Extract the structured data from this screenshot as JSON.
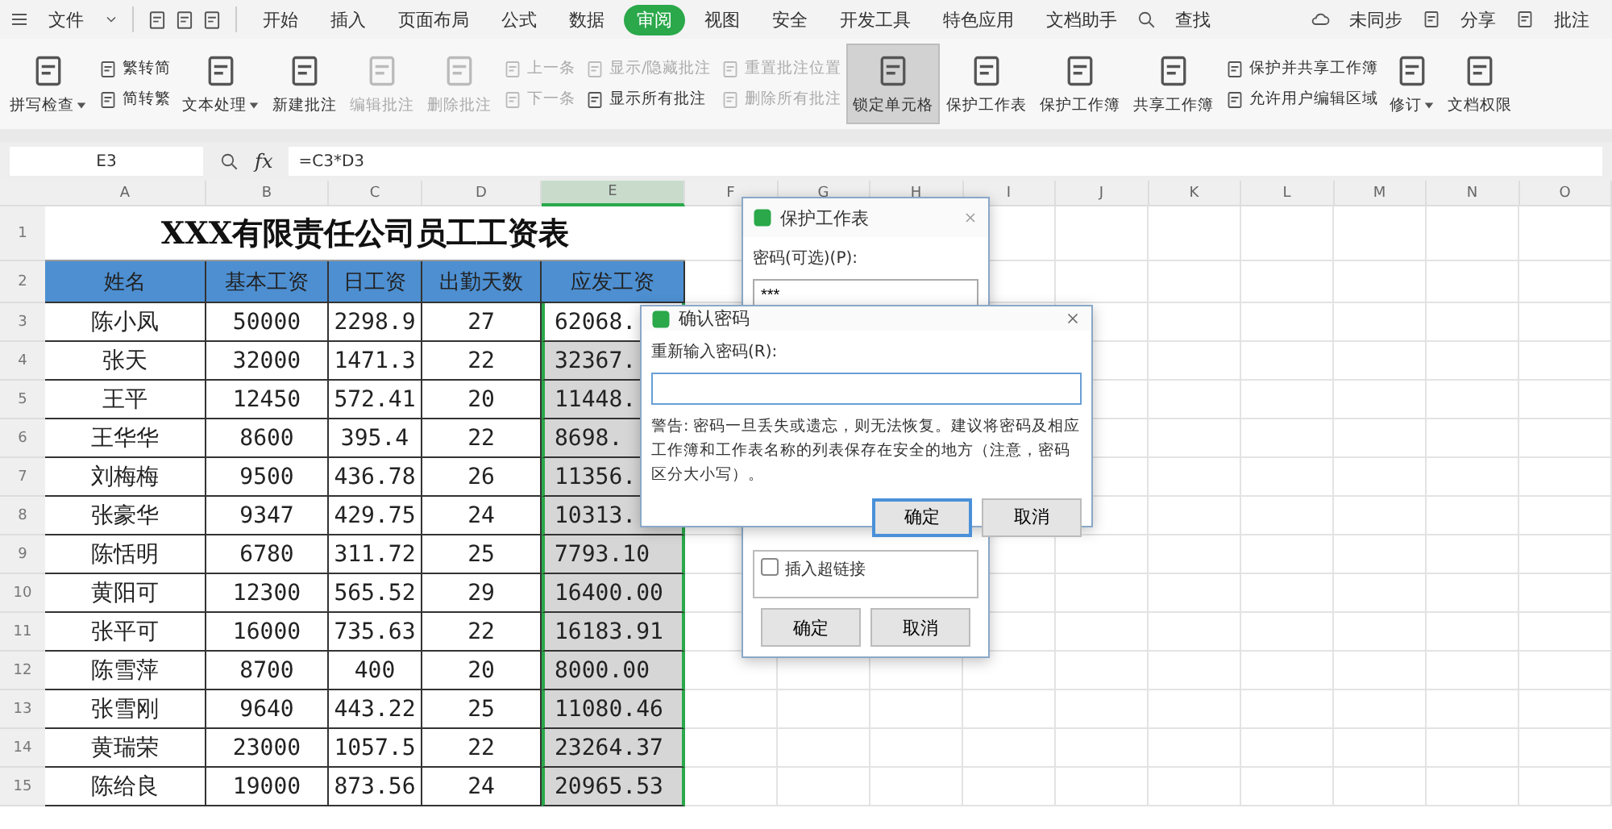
{
  "menu": {
    "file": "文件",
    "tabs": [
      {
        "label": "开始",
        "selected": false
      },
      {
        "label": "插入",
        "selected": false
      },
      {
        "label": "页面布局",
        "selected": false
      },
      {
        "label": "公式",
        "selected": false
      },
      {
        "label": "数据",
        "selected": false
      },
      {
        "label": "审阅",
        "selected": true
      },
      {
        "label": "视图",
        "selected": false
      },
      {
        "label": "安全",
        "selected": false
      },
      {
        "label": "开发工具",
        "selected": false
      },
      {
        "label": "特色应用",
        "selected": false
      },
      {
        "label": "文档助手",
        "selected": false
      }
    ],
    "search": "查找",
    "actions": [
      "未同步",
      "分享",
      "批注"
    ]
  },
  "ribbon": [
    {
      "kind": "large",
      "label": "拼写检查",
      "dropdown": true,
      "disabled": false,
      "selected": false
    },
    {
      "kind": "stack",
      "items": [
        {
          "label": "繁转简",
          "disabled": false
        },
        {
          "label": "简转繁",
          "disabled": false
        }
      ]
    },
    {
      "kind": "large",
      "label": "文本处理",
      "dropdown": true,
      "disabled": false,
      "selected": false
    },
    {
      "kind": "large",
      "label": "新建批注",
      "dropdown": false,
      "disabled": false,
      "selected": false
    },
    {
      "kind": "large",
      "label": "编辑批注",
      "dropdown": false,
      "disabled": true,
      "selected": false
    },
    {
      "kind": "large",
      "label": "删除批注",
      "dropdown": false,
      "disabled": true,
      "selected": false
    },
    {
      "kind": "stack",
      "items": [
        {
          "label": "上一条",
          "disabled": true
        },
        {
          "label": "下一条",
          "disabled": true
        }
      ]
    },
    {
      "kind": "stack",
      "items": [
        {
          "label": "显示/隐藏批注",
          "disabled": true
        },
        {
          "label": "显示所有批注",
          "disabled": false
        }
      ]
    },
    {
      "kind": "stack",
      "items": [
        {
          "label": "重置批注位置",
          "disabled": true
        },
        {
          "label": "删除所有批注",
          "disabled": true
        }
      ]
    },
    {
      "kind": "large",
      "label": "锁定单元格",
      "dropdown": false,
      "disabled": false,
      "selected": true
    },
    {
      "kind": "large",
      "label": "保护工作表",
      "dropdown": false,
      "disabled": false,
      "selected": false
    },
    {
      "kind": "large",
      "label": "保护工作簿",
      "dropdown": false,
      "disabled": false,
      "selected": false
    },
    {
      "kind": "large",
      "label": "共享工作簿",
      "dropdown": false,
      "disabled": false,
      "selected": false
    },
    {
      "kind": "stack",
      "items": [
        {
          "label": "保护并共享工作簿",
          "disabled": false
        },
        {
          "label": "允许用户编辑区域",
          "disabled": false
        }
      ]
    },
    {
      "kind": "large",
      "label": "修订",
      "dropdown": true,
      "disabled": false,
      "selected": false
    },
    {
      "kind": "large",
      "label": "文档权限",
      "dropdown": false,
      "disabled": false,
      "selected": false
    }
  ],
  "formula_bar": {
    "name_box": "E3",
    "fx": "fx",
    "formula": "=C3*D3"
  },
  "sheet": {
    "columns": [
      {
        "label": "A",
        "selected": false
      },
      {
        "label": "B",
        "selected": false
      },
      {
        "label": "C",
        "selected": false
      },
      {
        "label": "D",
        "selected": false
      },
      {
        "label": "E",
        "selected": true
      },
      {
        "label": "F",
        "selected": false
      },
      {
        "label": "G",
        "selected": false
      },
      {
        "label": "H",
        "selected": false
      },
      {
        "label": "I",
        "selected": false
      },
      {
        "label": "J",
        "selected": false
      },
      {
        "label": "K",
        "selected": false
      },
      {
        "label": "L",
        "selected": false
      },
      {
        "label": "M",
        "selected": false
      },
      {
        "label": "N",
        "selected": false
      },
      {
        "label": "O",
        "selected": false
      }
    ],
    "row_numbers": [
      "1",
      "2",
      "3",
      "4",
      "5",
      "6",
      "7",
      "8",
      "9",
      "10",
      "11",
      "12",
      "13",
      "14",
      "15"
    ],
    "title": "XXX有限责任公司员工工资表",
    "headers": [
      "姓名",
      "基本工资",
      "日工资",
      "出勤天数",
      "应发工资"
    ],
    "rows": [
      {
        "cells": [
          "陈小凤",
          "50000",
          "2298.9",
          "27",
          "62068."
        ],
        "highlighted": false
      },
      {
        "cells": [
          "张天",
          "32000",
          "1471.3",
          "22",
          "32367."
        ],
        "highlighted": true
      },
      {
        "cells": [
          "王平",
          "12450",
          "572.41",
          "20",
          "11448."
        ],
        "highlighted": true
      },
      {
        "cells": [
          "王华华",
          "8600",
          "395.4",
          "22",
          "8698."
        ],
        "highlighted": true
      },
      {
        "cells": [
          "刘梅梅",
          "9500",
          "436.78",
          "26",
          "11356."
        ],
        "highlighted": true
      },
      {
        "cells": [
          "张豪华",
          "9347",
          "429.75",
          "24",
          "10313."
        ],
        "highlighted": true
      },
      {
        "cells": [
          "陈恬明",
          "6780",
          "311.72",
          "25",
          "7793.10"
        ],
        "highlighted": true
      },
      {
        "cells": [
          "黄阳可",
          "12300",
          "565.52",
          "29",
          "16400.00"
        ],
        "highlighted": true
      },
      {
        "cells": [
          "张平可",
          "16000",
          "735.63",
          "22",
          "16183.91"
        ],
        "highlighted": true
      },
      {
        "cells": [
          "陈雪萍",
          "8700",
          "400",
          "20",
          "8000.00"
        ],
        "highlighted": true
      },
      {
        "cells": [
          "张雪刚",
          "9640",
          "443.22",
          "25",
          "11080.46"
        ],
        "highlighted": true
      },
      {
        "cells": [
          "黄瑞荣",
          "23000",
          "1057.5",
          "22",
          "23264.37"
        ],
        "highlighted": true
      },
      {
        "cells": [
          "陈给良",
          "19000",
          "873.56",
          "24",
          "20965.53"
        ],
        "highlighted": true
      }
    ]
  },
  "protect_dialog": {
    "title": "保护工作表",
    "label": "密码(可选)(P):",
    "value": "***",
    "options": [
      {
        "label": "插入超链接",
        "checked": false
      }
    ],
    "buttons": [
      "确定",
      "取消"
    ]
  },
  "confirm_dialog": {
    "title": "确认密码",
    "label": "重新输入密码(R):",
    "warning": "警告: 密码一旦丢失或遗忘，则无法恢复。建议将密码及相应工作簿和工作表名称的列表保存在安全的地方（注意，密码区分大小写）。",
    "buttons": [
      {
        "label": "确定",
        "default": true
      },
      {
        "label": "取消",
        "default": false
      }
    ]
  }
}
